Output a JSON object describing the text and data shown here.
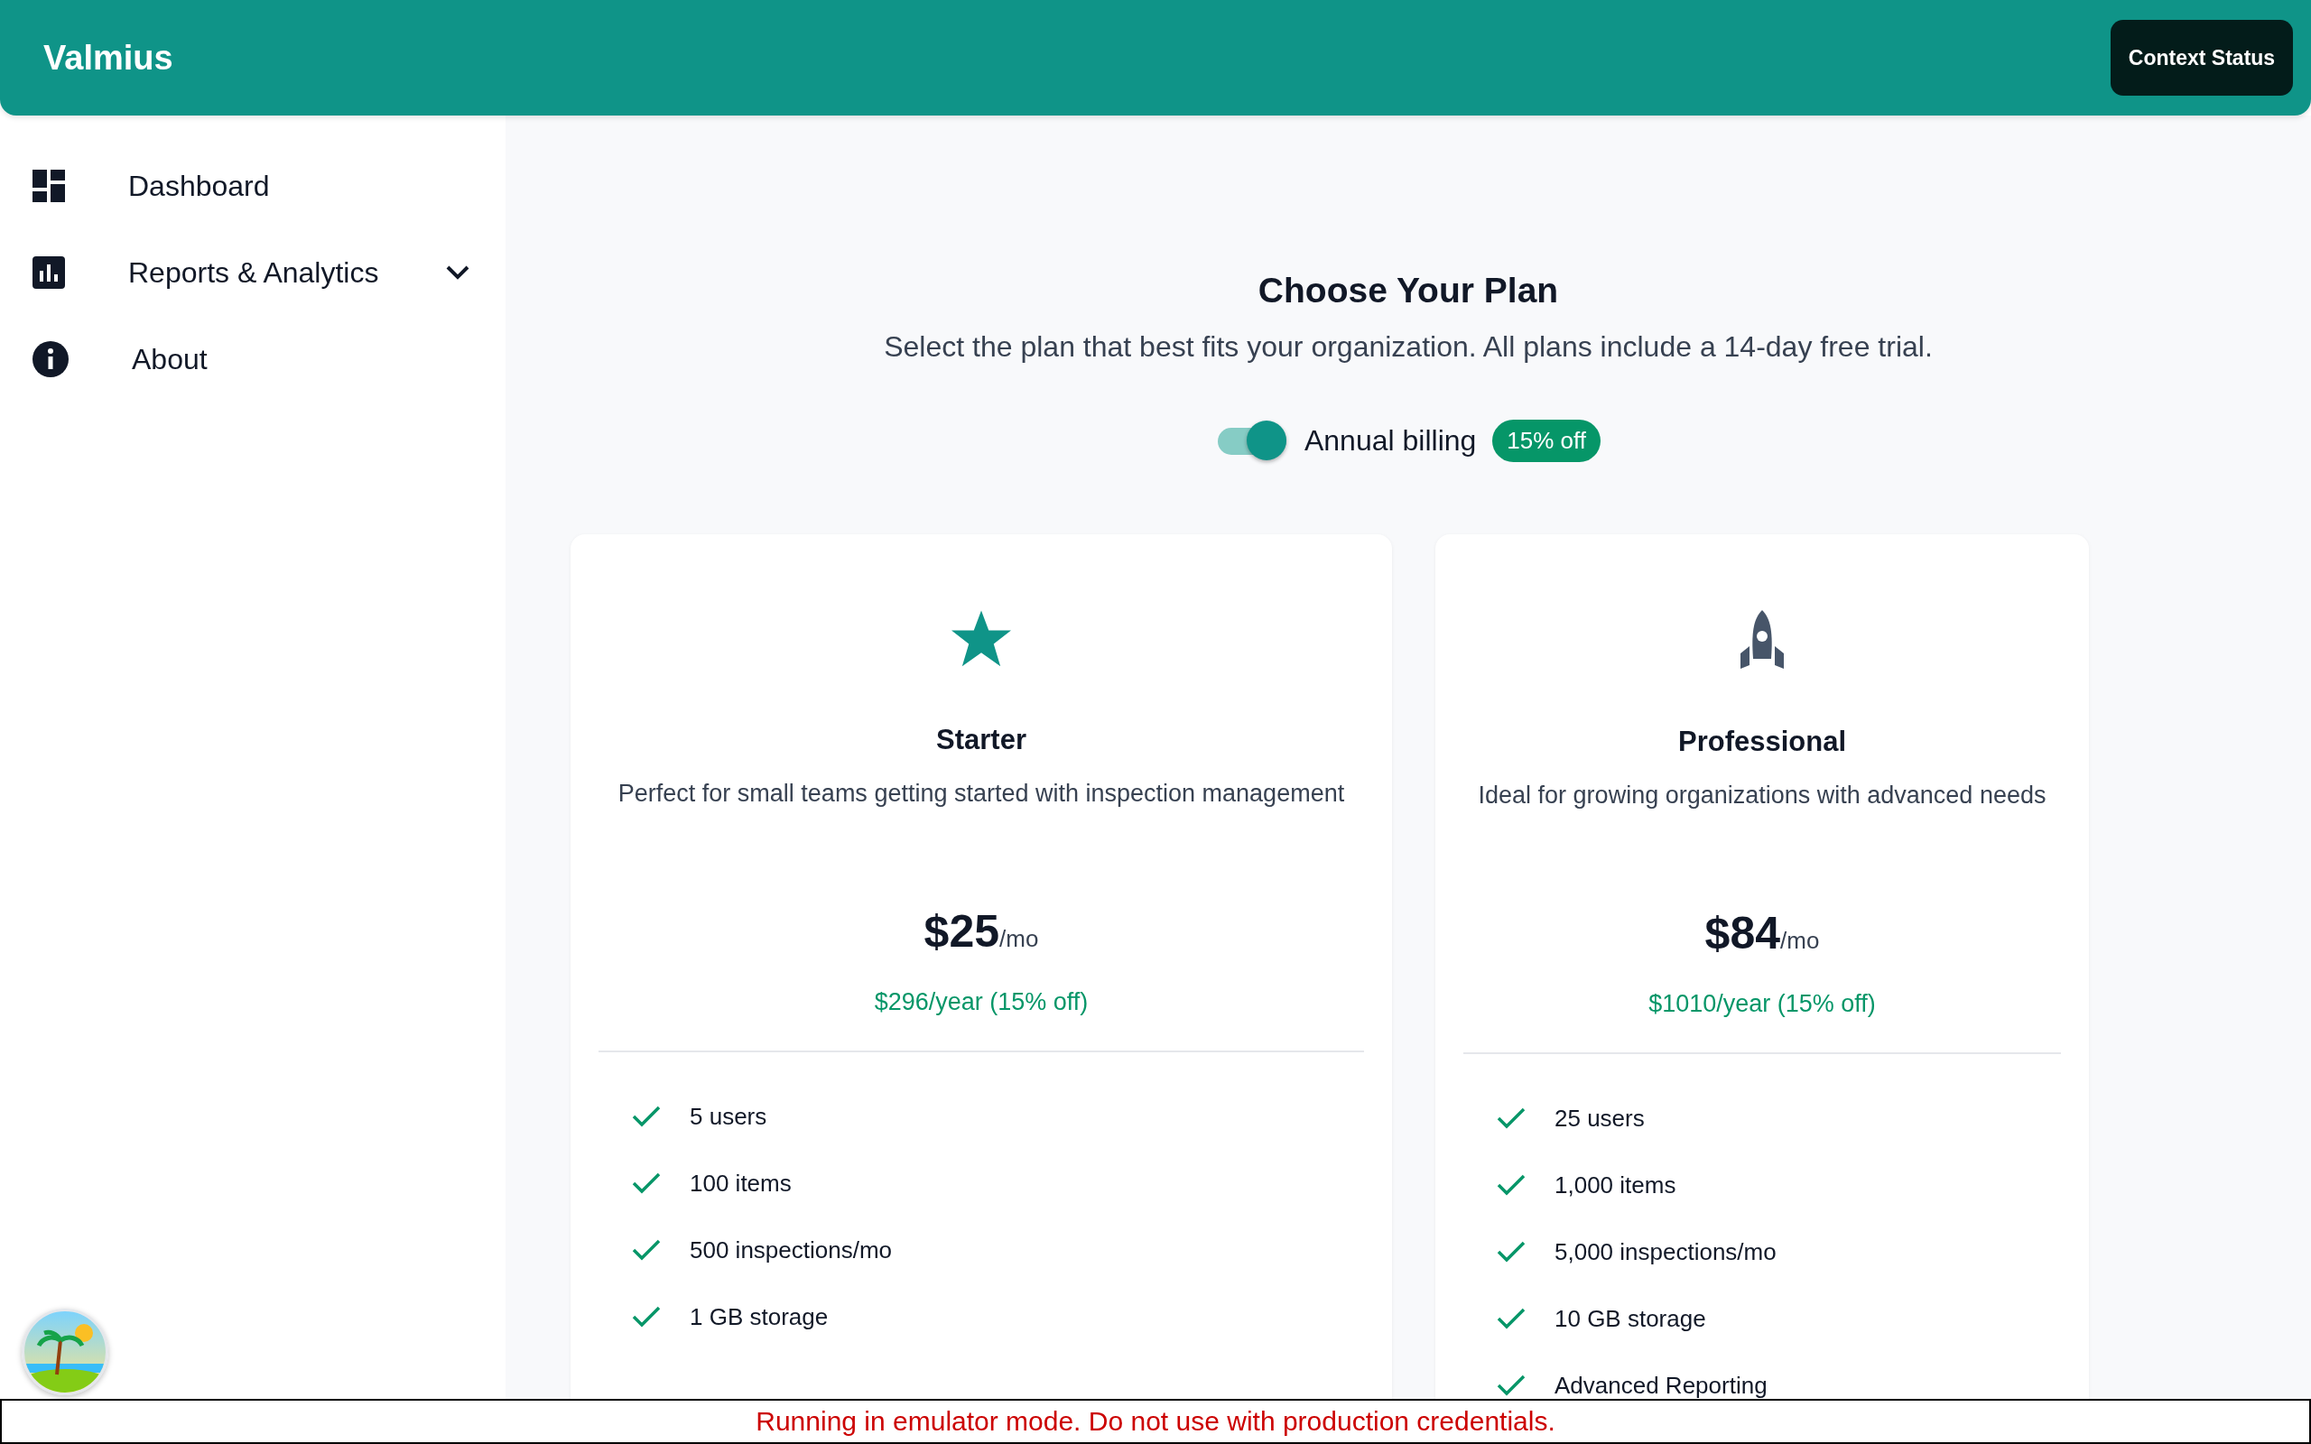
{
  "header": {
    "brand": "Valmius",
    "status_button": "Context Status"
  },
  "sidebar": {
    "items": [
      {
        "label": "Dashboard",
        "kind": "link"
      },
      {
        "label": "Reports & Analytics",
        "kind": "group"
      },
      {
        "label": "About",
        "kind": "link"
      }
    ]
  },
  "pricing": {
    "title": "Choose Your Plan",
    "subtitle": "Select the plan that best fits your organization. All plans include a 14-day free trial.",
    "billing_toggle": {
      "label": "Annual billing",
      "on": true,
      "badge": "15% off"
    },
    "plans": [
      {
        "name": "Starter",
        "description": "Perfect for small teams getting started with inspection management",
        "price": "$25",
        "period": "/mo",
        "yearly": "$296/year (15% off)",
        "features": [
          "5 users",
          "100 items",
          "500 inspections/mo",
          "1 GB storage"
        ]
      },
      {
        "name": "Professional",
        "description": "Ideal for growing organizations with advanced needs",
        "price": "$84",
        "period": "/mo",
        "yearly": "$1010/year (15% off)",
        "features": [
          "25 users",
          "1,000 items",
          "5,000 inspections/mo",
          "10 GB storage",
          "Advanced Reporting"
        ]
      }
    ]
  },
  "banner": "Running in emulator mode. Do not use with production credentials."
}
